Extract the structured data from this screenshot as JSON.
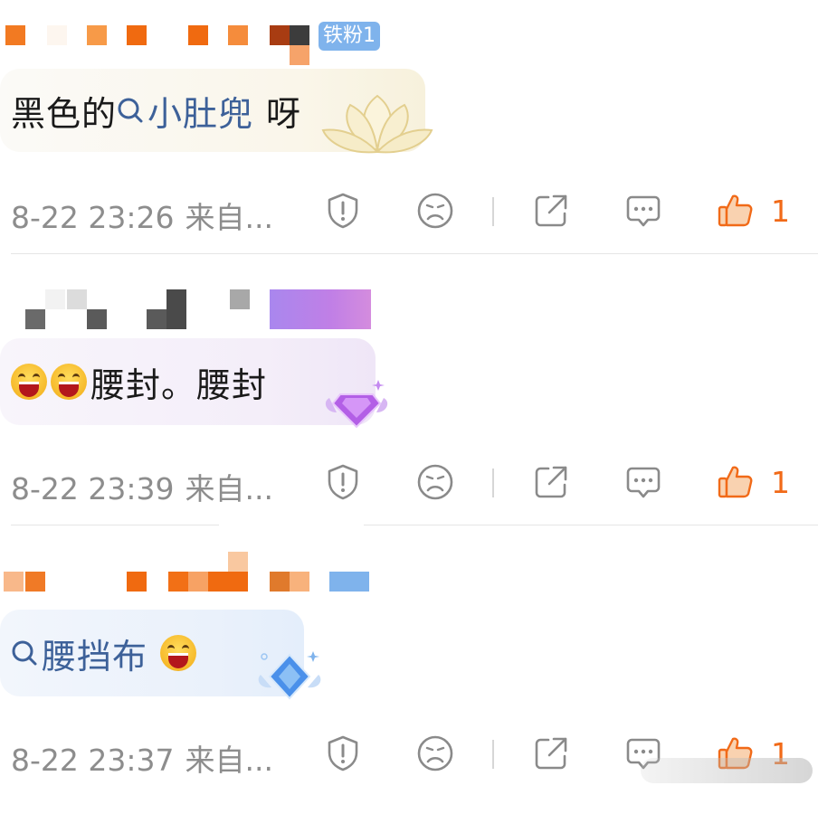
{
  "comments": [
    {
      "fan_badge": "铁粉1",
      "text": {
        "before": "黑色的",
        "topic": "小肚兜",
        "after": "呀"
      },
      "time": "8-22 23:26",
      "source": "来自...",
      "like_count": "1"
    },
    {
      "text": {
        "emoji_count": 2,
        "after": "腰封。腰封"
      },
      "time": "8-22 23:39",
      "source": "来自...",
      "like_count": "1"
    },
    {
      "text": {
        "topic": "腰挡布"
      },
      "time": "8-22 23:37",
      "source": "来自...",
      "like_count": "1"
    }
  ],
  "colors": {
    "topic": "#3d6199",
    "like": "#f16a18",
    "meta": "#8d8d8d"
  }
}
